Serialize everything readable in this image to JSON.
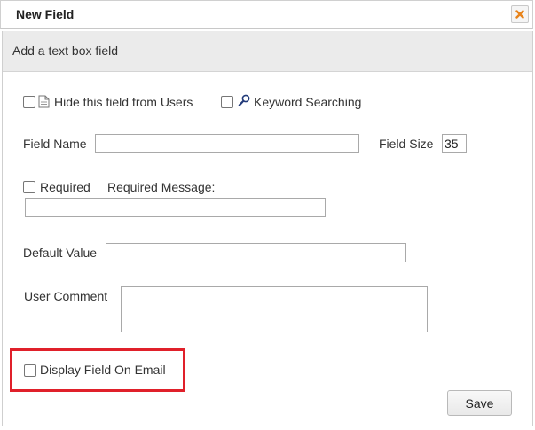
{
  "dialog": {
    "title": "New Field",
    "subtitle": "Add a text box field"
  },
  "options": {
    "hide_label": "Hide this field from Users",
    "keyword_label": "Keyword Searching"
  },
  "field_name": {
    "label": "Field Name",
    "value": ""
  },
  "field_size": {
    "label": "Field Size",
    "value": "35"
  },
  "required": {
    "label": "Required",
    "message_label": "Required Message:",
    "message_value": ""
  },
  "default_value": {
    "label": "Default Value",
    "value": ""
  },
  "user_comment": {
    "label": "User Comment",
    "value": ""
  },
  "display_email": {
    "label": "Display Field On Email"
  },
  "buttons": {
    "save": "Save"
  },
  "colors": {
    "highlight": "#e0202a",
    "close_icon": "#e8831a",
    "subheader_bg": "#ebebeb"
  },
  "icons": {
    "close": "close-x-icon",
    "hide": "document-icon",
    "keyword": "magnifier-icon"
  }
}
